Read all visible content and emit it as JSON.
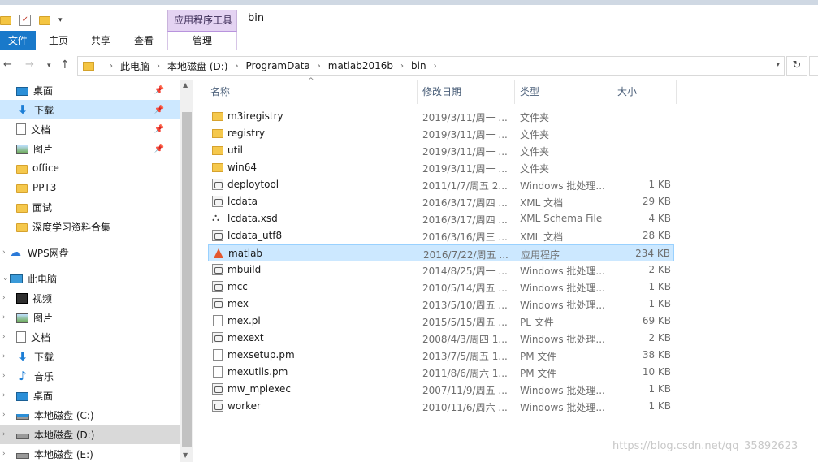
{
  "window": {
    "title": "bin",
    "context_group": "应用程序工具"
  },
  "ribbon": {
    "tabs": [
      "文件",
      "主页",
      "共享",
      "查看",
      "管理"
    ]
  },
  "address": {
    "crumbs": [
      "此电脑",
      "本地磁盘 (D:)",
      "ProgramData",
      "matlab2016b",
      "bin"
    ]
  },
  "nav": {
    "quick_access": [
      {
        "label": "桌面",
        "icon": "desktop-icon",
        "pinned": true
      },
      {
        "label": "下载",
        "icon": "download-icon",
        "pinned": true
      },
      {
        "label": "文档",
        "icon": "document-icon",
        "pinned": true
      },
      {
        "label": "图片",
        "icon": "picture-icon",
        "pinned": true
      },
      {
        "label": "office",
        "icon": "folder-icon",
        "pinned": false
      },
      {
        "label": "PPT3",
        "icon": "folder-icon",
        "pinned": false
      },
      {
        "label": "面试",
        "icon": "folder-icon",
        "pinned": false
      },
      {
        "label": "深度学习资料合集",
        "icon": "folder-icon",
        "pinned": false
      }
    ],
    "wps": "WPS网盘",
    "this_pc": "此电脑",
    "pc_items": [
      {
        "label": "视频",
        "icon": "video-icon"
      },
      {
        "label": "图片",
        "icon": "picture-icon"
      },
      {
        "label": "文档",
        "icon": "document-icon"
      },
      {
        "label": "下载",
        "icon": "download-icon"
      },
      {
        "label": "音乐",
        "icon": "music-icon"
      },
      {
        "label": "桌面",
        "icon": "desktop-icon"
      },
      {
        "label": "本地磁盘 (C:)",
        "icon": "system-drive-icon"
      },
      {
        "label": "本地磁盘 (D:)",
        "icon": "drive-icon"
      },
      {
        "label": "本地磁盘 (E:)",
        "icon": "drive-icon"
      }
    ]
  },
  "columns": {
    "name": "名称",
    "date": "修改日期",
    "type": "类型",
    "size": "大小"
  },
  "files": [
    {
      "name": "m3iregistry",
      "date": "2019/3/11/周一 ...",
      "type": "文件夹",
      "size": "",
      "icon": "folder-icon"
    },
    {
      "name": "registry",
      "date": "2019/3/11/周一 ...",
      "type": "文件夹",
      "size": "",
      "icon": "folder-icon"
    },
    {
      "name": "util",
      "date": "2019/3/11/周一 ...",
      "type": "文件夹",
      "size": "",
      "icon": "folder-icon"
    },
    {
      "name": "win64",
      "date": "2019/3/11/周一 ...",
      "type": "文件夹",
      "size": "",
      "icon": "folder-icon"
    },
    {
      "name": "deploytool",
      "date": "2011/1/7/周五 2...",
      "type": "Windows 批处理...",
      "size": "1 KB",
      "icon": "batch-file-icon"
    },
    {
      "name": "lcdata",
      "date": "2016/3/17/周四 ...",
      "type": "XML 文档",
      "size": "29 KB",
      "icon": "xml-file-icon"
    },
    {
      "name": "lcdata.xsd",
      "date": "2016/3/17/周四 ...",
      "type": "XML Schema File",
      "size": "4 KB",
      "icon": "schema-file-icon"
    },
    {
      "name": "lcdata_utf8",
      "date": "2016/3/16/周三 ...",
      "type": "XML 文档",
      "size": "28 KB",
      "icon": "xml-file-icon"
    },
    {
      "name": "matlab",
      "date": "2016/7/22/周五 ...",
      "type": "应用程序",
      "size": "234 KB",
      "icon": "matlab-app-icon"
    },
    {
      "name": "mbuild",
      "date": "2014/8/25/周一 ...",
      "type": "Windows 批处理...",
      "size": "2 KB",
      "icon": "batch-file-icon"
    },
    {
      "name": "mcc",
      "date": "2010/5/14/周五 ...",
      "type": "Windows 批处理...",
      "size": "1 KB",
      "icon": "batch-file-icon"
    },
    {
      "name": "mex",
      "date": "2013/5/10/周五 ...",
      "type": "Windows 批处理...",
      "size": "1 KB",
      "icon": "batch-file-icon"
    },
    {
      "name": "mex.pl",
      "date": "2015/5/15/周五 ...",
      "type": "PL 文件",
      "size": "69 KB",
      "icon": "file-icon"
    },
    {
      "name": "mexext",
      "date": "2008/4/3/周四 1...",
      "type": "Windows 批处理...",
      "size": "2 KB",
      "icon": "batch-file-icon"
    },
    {
      "name": "mexsetup.pm",
      "date": "2013/7/5/周五 1...",
      "type": "PM 文件",
      "size": "38 KB",
      "icon": "file-icon"
    },
    {
      "name": "mexutils.pm",
      "date": "2011/8/6/周六 1...",
      "type": "PM 文件",
      "size": "10 KB",
      "icon": "file-icon"
    },
    {
      "name": "mw_mpiexec",
      "date": "2007/11/9/周五 ...",
      "type": "Windows 批处理...",
      "size": "1 KB",
      "icon": "batch-file-icon"
    },
    {
      "name": "worker",
      "date": "2010/11/6/周六 ...",
      "type": "Windows 批处理...",
      "size": "1 KB",
      "icon": "batch-file-icon"
    }
  ],
  "selected_file": "matlab",
  "watermark": "https://blog.csdn.net/qq_35892623",
  "colors": {
    "file_tab": "#1979ca",
    "context_tab": "#e4d3f2",
    "selection": "#cce8ff",
    "nav_current": "#d9d9d9"
  }
}
